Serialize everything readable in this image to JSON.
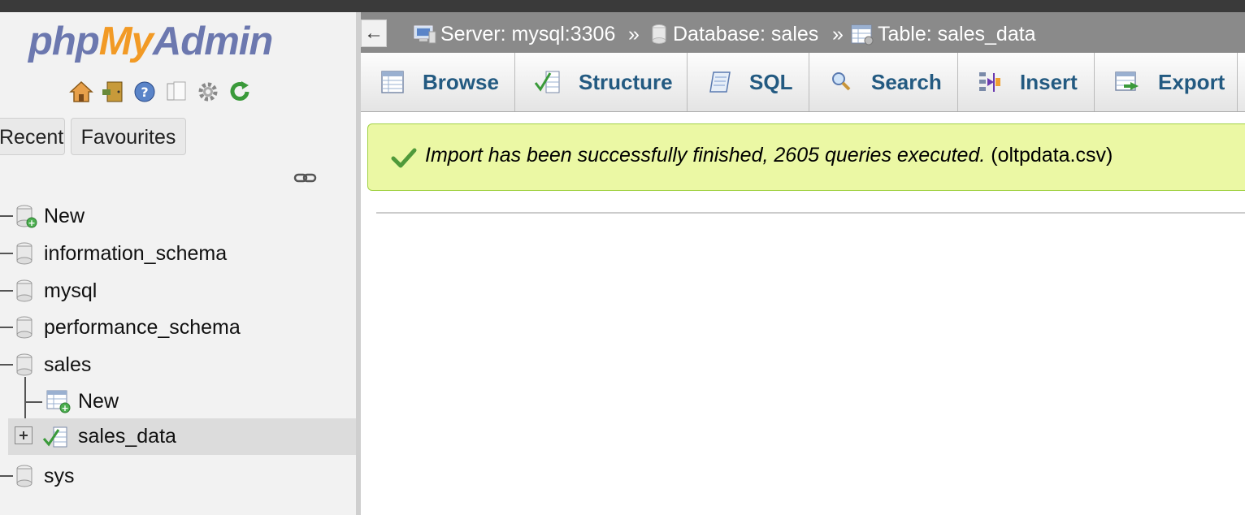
{
  "logo": {
    "php": "php",
    "my": "My",
    "admin": "Admin"
  },
  "quick_icons": [
    "home-icon",
    "exit-icon",
    "help-icon",
    "docs-icon",
    "settings-icon",
    "reload-icon"
  ],
  "sidebar_tabs": {
    "recent": "Recent",
    "favourites": "Favourites"
  },
  "tree": {
    "new_db": "New",
    "databases": [
      "information_schema",
      "mysql",
      "performance_schema",
      "sales",
      "sys"
    ],
    "sales_children": {
      "new_table": "New",
      "table": "sales_data"
    }
  },
  "breadcrumb": {
    "server": "Server: mysql:3306",
    "database": "Database: sales",
    "table": "Table: sales_data",
    "separator": "»"
  },
  "tabs": [
    "Browse",
    "Structure",
    "SQL",
    "Search",
    "Insert",
    "Export"
  ],
  "message": {
    "main": "Import has been successfully finished, 2605 queries executed.",
    "file": "(oltpdata.csv)"
  },
  "colors": {
    "accent": "#235a81",
    "success_bg": "#ebf8a4",
    "success_border": "#a2d246",
    "logo_blue": "#6c78af",
    "logo_orange": "#f29a25"
  }
}
